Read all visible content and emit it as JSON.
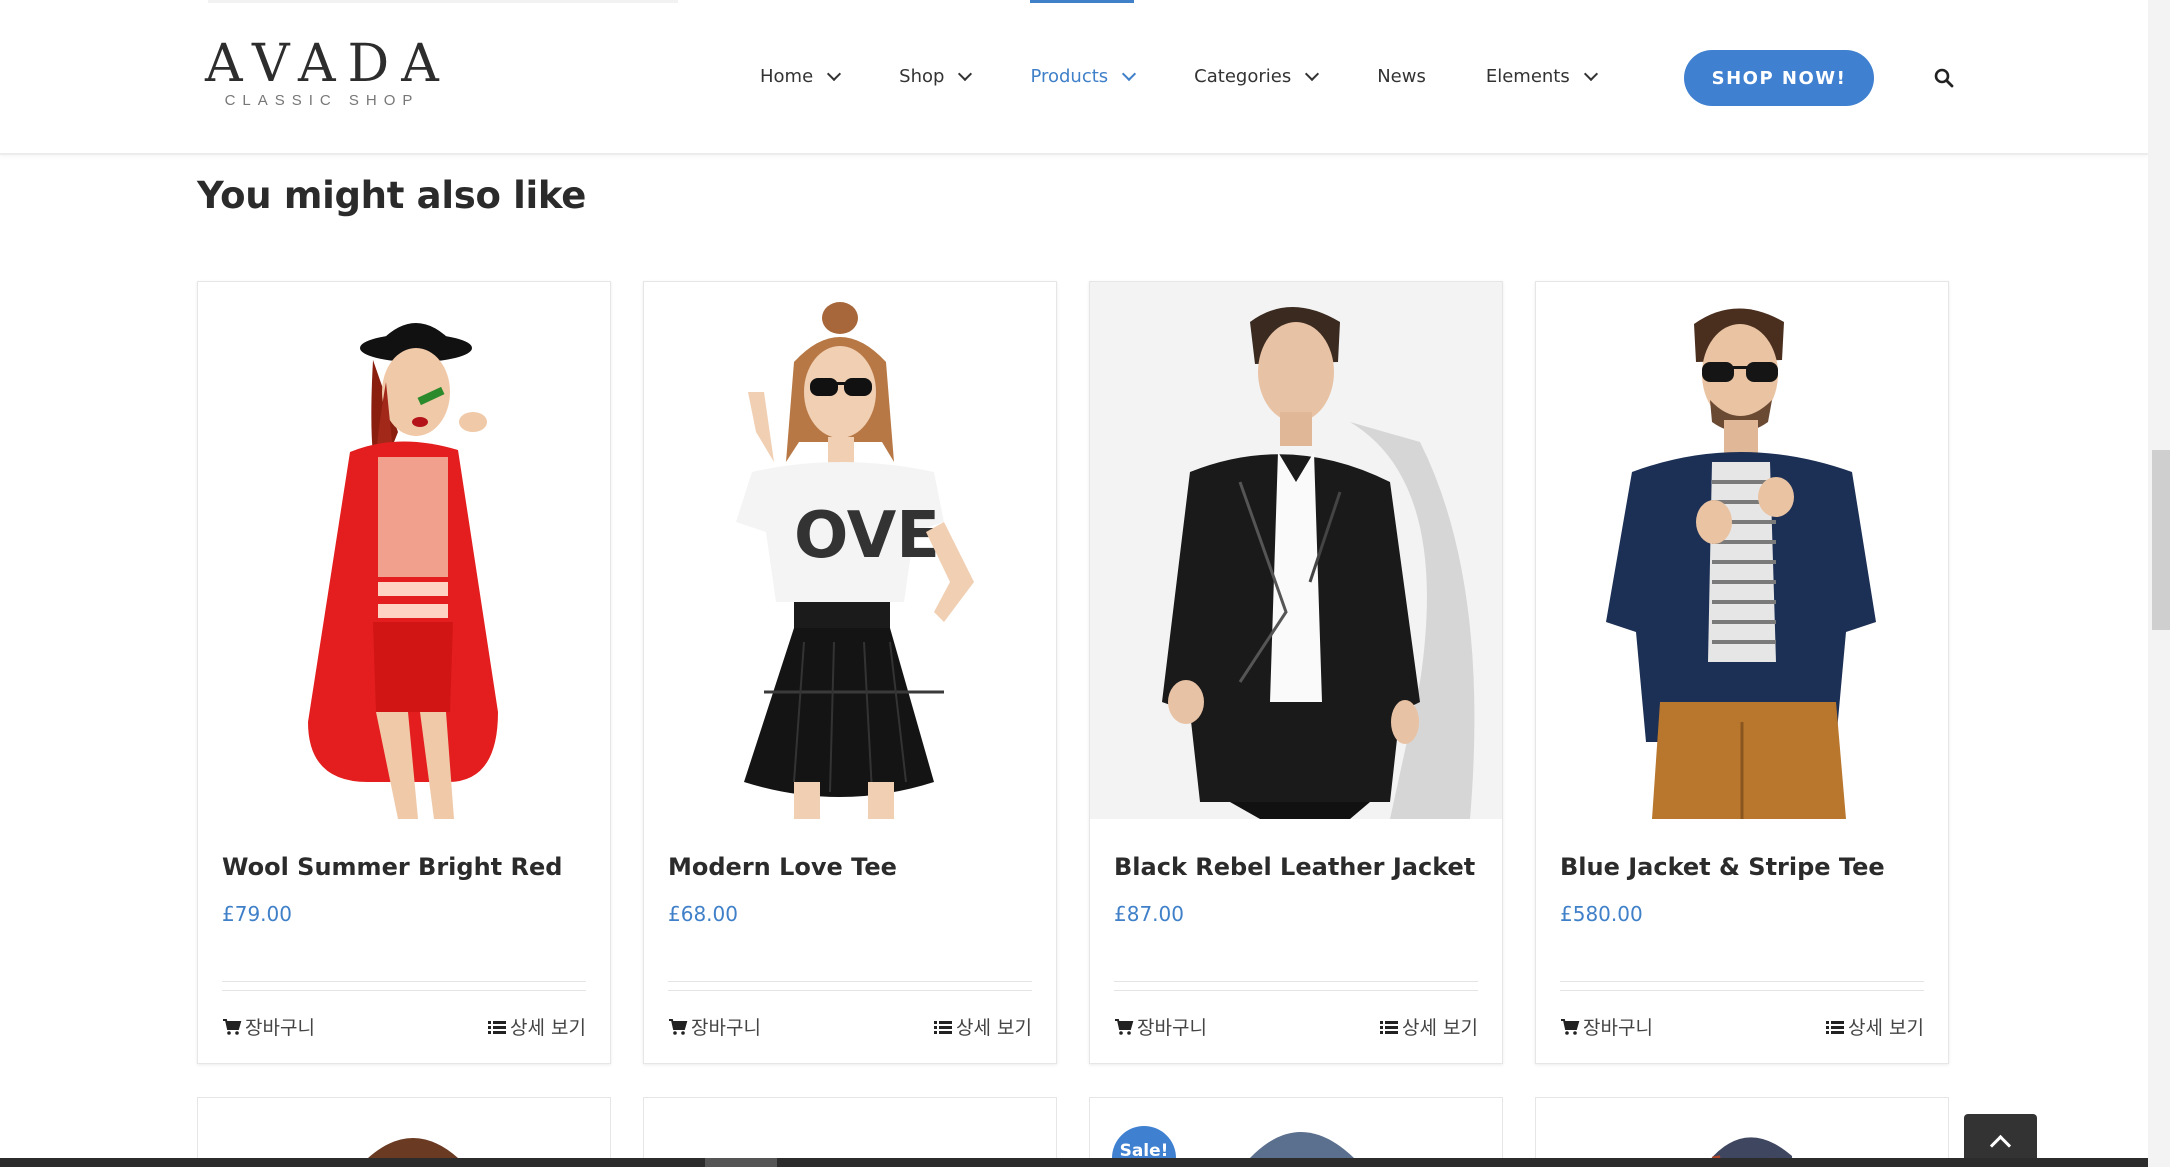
{
  "brand": {
    "name": "AVADA",
    "tagline": "CLASSIC SHOP"
  },
  "nav": {
    "items": [
      {
        "label": "Home",
        "has_dropdown": true
      },
      {
        "label": "Shop",
        "has_dropdown": true
      },
      {
        "label": "Products",
        "has_dropdown": true,
        "active": true
      },
      {
        "label": "Categories",
        "has_dropdown": true
      },
      {
        "label": "News",
        "has_dropdown": false
      },
      {
        "label": "Elements",
        "has_dropdown": true
      }
    ],
    "cta_label": "SHOP NOW!",
    "search_icon": "search-icon"
  },
  "section": {
    "title": "You might also like"
  },
  "products": [
    {
      "name": "Wool Summer Bright Red",
      "price": "£79.00",
      "cart_label": "장바구니",
      "details_label": "상세 보기"
    },
    {
      "name": "Modern Love Tee",
      "price": "£68.00",
      "cart_label": "장바구니",
      "details_label": "상세 보기"
    },
    {
      "name": "Black Rebel Leather Jacket",
      "price": "£87.00",
      "cart_label": "장바구니",
      "details_label": "상세 보기"
    },
    {
      "name": "Blue Jacket & Stripe Tee",
      "price": "£580.00",
      "cart_label": "장바구니",
      "details_label": "상세 보기"
    }
  ],
  "second_row": {
    "badge": "Sale!"
  },
  "colors": {
    "accent": "#3f80c9",
    "button": "#3f80d0",
    "heading": "#2b2b2b"
  }
}
